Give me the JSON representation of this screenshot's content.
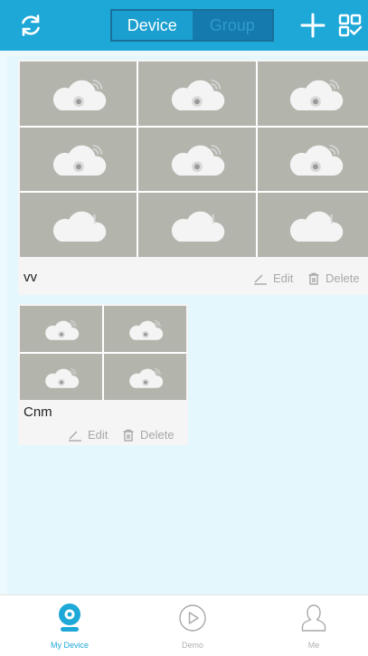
{
  "topbar": {
    "tabs": [
      {
        "label": "Device",
        "active": true
      },
      {
        "label": "Group",
        "active": false
      }
    ],
    "refresh_icon": "refresh-icon",
    "add_icon": "plus-icon",
    "scan_icon": "qr-scan-icon"
  },
  "groups": [
    {
      "name": "vv",
      "edit_label": "Edit",
      "delete_label": "Delete",
      "cells": [
        "cloud-wifi",
        "cloud-wifi",
        "cloud-wifi",
        "cloud-wifi",
        "cloud-wifi",
        "cloud-wifi",
        "cloud-offline",
        "cloud-offline",
        "cloud-offline"
      ]
    },
    {
      "name": "Cnm",
      "edit_label": "Edit",
      "delete_label": "Delete",
      "cells": [
        "cloud-wifi",
        "cloud-wifi",
        "cloud-wifi",
        "cloud-wifi"
      ]
    }
  ],
  "bottom_nav": [
    {
      "label": "My Device",
      "icon": "camera-icon",
      "active": true
    },
    {
      "label": "Demo",
      "icon": "play-icon",
      "active": false
    },
    {
      "label": "Me",
      "icon": "user-icon",
      "active": false
    }
  ],
  "colors": {
    "accent": "#1ea8d8",
    "thumbnail_bg": "#b3b5ad",
    "page_bg": "#e4f7fc"
  }
}
